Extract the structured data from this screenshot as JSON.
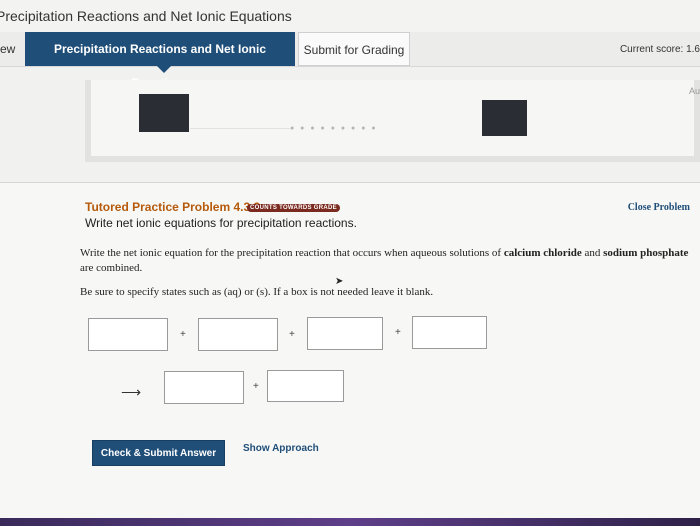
{
  "window": {
    "title": "Precipitation Reactions and Net Ionic Equations"
  },
  "tabs": {
    "prev_label": "ew",
    "active_label": "Precipitation Reactions and Net Ionic Equations",
    "submit_label": "Submit for Grading"
  },
  "score": {
    "label": "Current score: 1.6"
  },
  "header_panel": {
    "right_text": "Au"
  },
  "problem": {
    "title": "Tutored Practice Problem 4.3.2",
    "badge": "COUNTS TOWARDS GRADE",
    "subtitle": "Write net ionic equations for precipitation reactions.",
    "close_label": "Close Problem",
    "question_prefix": "Write the net ionic equation for the precipitation reaction that occurs when aqueous solutions of ",
    "reactant_1": "calcium chloride",
    "question_and": " and ",
    "reactant_2": "sodium phosphate",
    "question_suffix": " are combined.",
    "instruction": "Be sure to specify states such as (aq) or (s). If a box is not needed leave it blank."
  },
  "equation": {
    "plus": "+",
    "arrow": "⟶",
    "reactant_boxes": [
      "",
      "",
      "",
      ""
    ],
    "product_boxes": [
      "",
      ""
    ]
  },
  "actions": {
    "check_label": "Check & Submit Answer",
    "approach_label": "Show Approach"
  }
}
